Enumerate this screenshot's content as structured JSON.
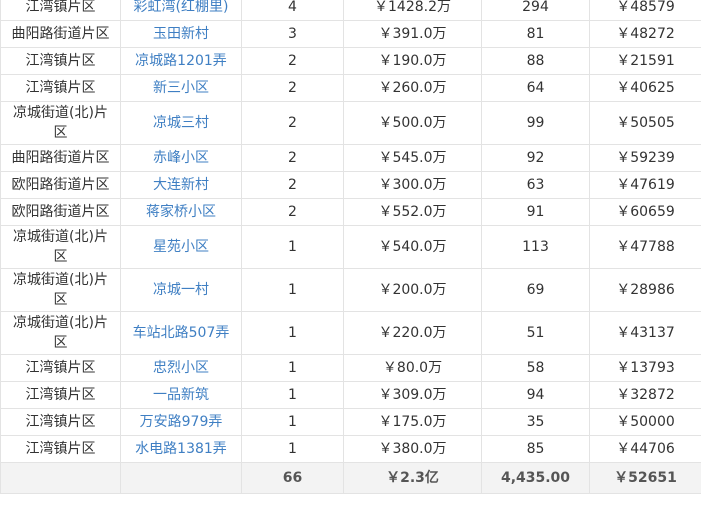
{
  "rows": [
    {
      "area": "江湾镇片区",
      "community": "彩虹湾(红棚里)",
      "count": "4",
      "total": "￥1428.2万",
      "size": "294",
      "unit_price": "￥48579"
    },
    {
      "area": "曲阳路街道片区",
      "community": "玉田新村",
      "count": "3",
      "total": "￥391.0万",
      "size": "81",
      "unit_price": "￥48272"
    },
    {
      "area": "江湾镇片区",
      "community": "凉城路1201弄",
      "count": "2",
      "total": "￥190.0万",
      "size": "88",
      "unit_price": "￥21591"
    },
    {
      "area": "江湾镇片区",
      "community": "新三小区",
      "count": "2",
      "total": "￥260.0万",
      "size": "64",
      "unit_price": "￥40625"
    },
    {
      "area": "凉城街道(北)片区",
      "community": "凉城三村",
      "count": "2",
      "total": "￥500.0万",
      "size": "99",
      "unit_price": "￥50505"
    },
    {
      "area": "曲阳路街道片区",
      "community": "赤峰小区",
      "count": "2",
      "total": "￥545.0万",
      "size": "92",
      "unit_price": "￥59239"
    },
    {
      "area": "欧阳路街道片区",
      "community": "大连新村",
      "count": "2",
      "total": "￥300.0万",
      "size": "63",
      "unit_price": "￥47619"
    },
    {
      "area": "欧阳路街道片区",
      "community": "蒋家桥小区",
      "count": "2",
      "total": "￥552.0万",
      "size": "91",
      "unit_price": "￥60659"
    },
    {
      "area": "凉城街道(北)片区",
      "community": "星苑小区",
      "count": "1",
      "total": "￥540.0万",
      "size": "113",
      "unit_price": "￥47788"
    },
    {
      "area": "凉城街道(北)片区",
      "community": "凉城一村",
      "count": "1",
      "total": "￥200.0万",
      "size": "69",
      "unit_price": "￥28986"
    },
    {
      "area": "凉城街道(北)片区",
      "community": "车站北路507弄",
      "count": "1",
      "total": "￥220.0万",
      "size": "51",
      "unit_price": "￥43137"
    },
    {
      "area": "江湾镇片区",
      "community": "忠烈小区",
      "count": "1",
      "total": "￥80.0万",
      "size": "58",
      "unit_price": "￥13793"
    },
    {
      "area": "江湾镇片区",
      "community": "一品新筑",
      "count": "1",
      "total": "￥309.0万",
      "size": "94",
      "unit_price": "￥32872"
    },
    {
      "area": "江湾镇片区",
      "community": "万安路979弄",
      "count": "1",
      "total": "￥175.0万",
      "size": "35",
      "unit_price": "￥50000"
    },
    {
      "area": "江湾镇片区",
      "community": "水电路1381弄",
      "count": "1",
      "total": "￥380.0万",
      "size": "85",
      "unit_price": "￥44706"
    }
  ],
  "totals": {
    "area": "",
    "community": "",
    "count": "66",
    "total": "￥2.3亿",
    "size": "4,435.00",
    "unit_price": "￥52651"
  },
  "colors": {
    "link": "#3f7fc3",
    "border": "#e3e3e3",
    "footer_bg": "#f3f3f3"
  }
}
